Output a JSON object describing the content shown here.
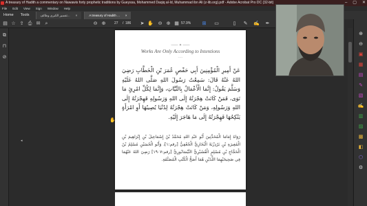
{
  "window": {
    "title": "A treasury of Hadith a commentary on Nawawis forty prophetic traditions by Gueyssa, Mohammed Daqiq al-Id, Muhammad ibn Ali (z-lib.org).pdf - Adobe Acrobat Pro DC (32-bit)",
    "minimize": "–",
    "maximize": "▢",
    "close": "✕"
  },
  "menu": [
    "File",
    "Edit",
    "View",
    "Sign",
    "Window",
    "Help"
  ],
  "tabs": {
    "home": "Home",
    "tools": "Tools",
    "docs": [
      {
        "label": "تفسير الكبرى وطائف...",
        "close": "×"
      },
      {
        "label": "A treasury of Hadith ...",
        "close": "×"
      }
    ]
  },
  "toolbar": {
    "page_current": "27",
    "page_sep": "/",
    "page_total": "186",
    "zoom": "57.9%"
  },
  "page": {
    "ornament_top": "—— ✦ ——",
    "title": "Works Are Only According to Intentions",
    "ornament_bottom": "~~~",
    "hadith": "عَنْ أَمِيرِ الْمُؤْمِنِينَ أَبِي حَفْصٍ عُمَرَ بْنِ الْخَطَّابِ رَضِيَ اللهُ عَنْهُ قَالَ: سَمِعْتُ رَسُولَ اللهِ صَلَّى اللهُ عَلَيْهِ وَسَلَّمَ يَقُولُ: إِنَّمَا الْأَعْمَالُ بِالنِّيَّاتِ، وَإِنَّمَا لِكُلِّ امْرِئٍ مَا نَوَى، فَمَنْ كَانَتْ هِجْرَتُهُ إِلَى اللهِ وَرَسُولِهِ فَهِجْرَتُهُ إِلَى اللهِ وَرَسُولِهِ، وَمَنْ كَانَتْ هِجْرَتُهُ لِدُنْيَا يُصِيبُهَا أَوِ امْرَأَةٍ يَنْكِحُهَا فَهِجْرَتُهُ إِلَى مَا هَاجَرَ إِلَيْهِ.",
    "narration": "رَوَاهُ إِمَامَا الْمُحَدِّثِينَ أَبُو عَبْدِ اللهِ مُحَمَّدُ بْنُ إِسْمَاعِيلَ بْنِ إِبْرَاهِيمَ بْنِ الْمُغِيرَةِ بْنِ بَرْدِزْبَهْ الْبُخَارِيُّ الْجُعْفِيُّ [رقم:١]، وَأَبُو الْحُسَيْنِ مُسْلِمُ بْنُ الْحَجَّاجِ بْنِ مُسْلِمٍ الْقُشَيْرِيُّ النَّيْسَابُورِيُّ [رقم:١٩٠٧] رَضِيَ اللهُ عَنْهُمَا فِي صَحِيحَيْهِمَا اللَّذَيْنِ هُمَا أَصَحُّ الْكُتُبِ الْمُصَنَّفَةِ."
  },
  "colors": {
    "chrome": "#323232",
    "canvas": "#2b2b2b",
    "page": "#ffffff",
    "accent": "#4b8df7",
    "titlebar": "#3a1f1f"
  }
}
